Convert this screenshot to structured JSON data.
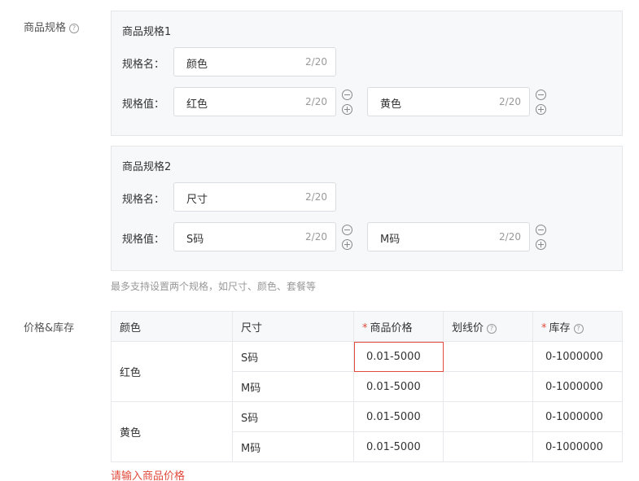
{
  "spec_section": {
    "label": "商品规格",
    "help_glyph": "?",
    "groups": [
      {
        "title": "商品规格1",
        "name_label": "规格名：",
        "name_value": "颜色",
        "name_count": "2/20",
        "value_label": "规格值：",
        "values": [
          {
            "text": "红色",
            "count": "2/20"
          },
          {
            "text": "黄色",
            "count": "2/20"
          }
        ]
      },
      {
        "title": "商品规格2",
        "name_label": "规格名：",
        "name_value": "尺寸",
        "name_count": "2/20",
        "value_label": "规格值：",
        "values": [
          {
            "text": "S码",
            "count": "2/20"
          },
          {
            "text": "M码",
            "count": "2/20"
          }
        ]
      }
    ],
    "hint": "最多支持设置两个规格，如尺寸、颜色、套餐等"
  },
  "price_section": {
    "label": "价格&库存",
    "headers": {
      "color": "颜色",
      "size": "尺寸",
      "price": "商品价格",
      "strike_price": "划线价",
      "stock": "库存",
      "required_mark": "*"
    },
    "rows": [
      {
        "color": "红色",
        "size": "S码",
        "price_placeholder": "0.01-5000",
        "stock_placeholder": "0-1000000"
      },
      {
        "color": "",
        "size": "M码",
        "price_placeholder": "0.01-5000",
        "stock_placeholder": "0-1000000"
      },
      {
        "color": "黄色",
        "size": "S码",
        "price_placeholder": "0.01-5000",
        "stock_placeholder": "0-1000000"
      },
      {
        "color": "",
        "size": "M码",
        "price_placeholder": "0.01-5000",
        "stock_placeholder": "0-1000000"
      }
    ],
    "error": "请输入商品价格"
  },
  "colors": {
    "error": "#e14a3c",
    "panel_bg": "#f7f8fa",
    "border": "#d9dce1"
  }
}
